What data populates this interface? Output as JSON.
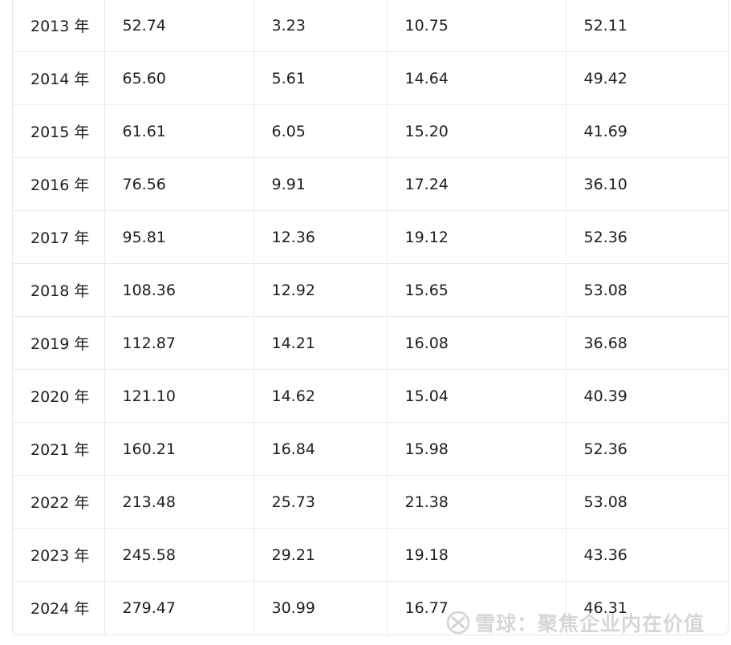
{
  "table": {
    "rows": [
      [
        "2013 年",
        "52.74",
        "3.23",
        "10.75",
        "52.11"
      ],
      [
        "2014 年",
        "65.60",
        "5.61",
        "14.64",
        "49.42"
      ],
      [
        "2015 年",
        "61.61",
        "6.05",
        "15.20",
        "41.69"
      ],
      [
        "2016 年",
        "76.56",
        "9.91",
        "17.24",
        "36.10"
      ],
      [
        "2017 年",
        "95.81",
        "12.36",
        "19.12",
        "52.36"
      ],
      [
        "2018 年",
        "108.36",
        "12.92",
        "15.65",
        "53.08"
      ],
      [
        "2019 年",
        "112.87",
        "14.21",
        "16.08",
        "36.68"
      ],
      [
        "2020 年",
        "121.10",
        "14.62",
        "15.04",
        "40.39"
      ],
      [
        "2021 年",
        "160.21",
        "16.84",
        "15.98",
        "52.36"
      ],
      [
        "2022 年",
        "213.48",
        "25.73",
        "21.38",
        "53.08"
      ],
      [
        "2023 年",
        "245.58",
        "29.21",
        "19.18",
        "43.36"
      ],
      [
        "2024 年",
        "279.47",
        "30.99",
        "16.77",
        "46.31"
      ]
    ]
  },
  "watermark": {
    "text": "雪球：聚焦企业内在价值",
    "icon": "snowball-logo-icon",
    "color": "#c8c8c8"
  }
}
